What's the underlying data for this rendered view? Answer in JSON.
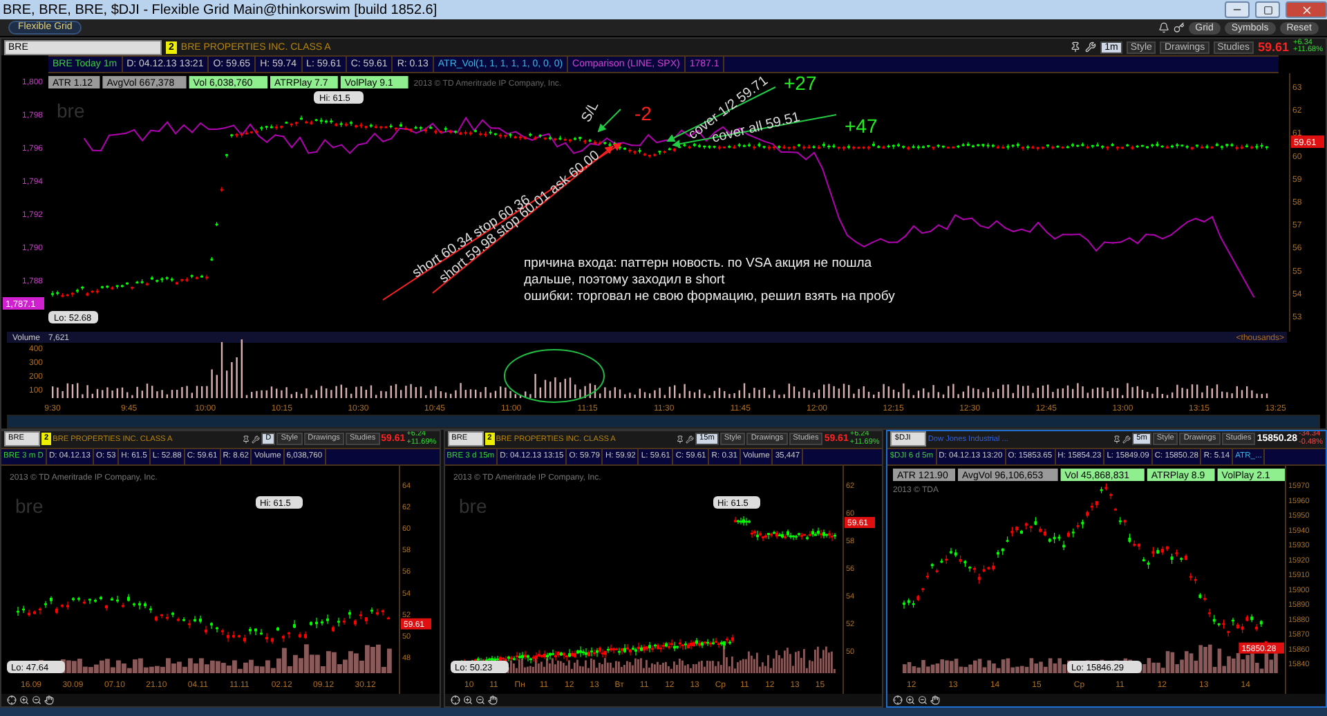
{
  "window": {
    "title": "BRE, BRE, BRE, $DJI - Flexible Grid Main@thinkorswim [build 1852.6]"
  },
  "toolbar": {
    "tab": "Flexible Grid",
    "buttons": [
      "Grid",
      "Symbols",
      "Reset"
    ]
  },
  "main_panel": {
    "symbol": "BRE",
    "badge": "2",
    "company": "BRE PROPERTIES INC. CLASS A",
    "timeframe": "1m",
    "tools": [
      "Style",
      "Drawings",
      "Studies"
    ],
    "last": "59.61",
    "change": "+6.34",
    "change_pct": "+11.68%",
    "info": [
      {
        "kind": "label",
        "text": "BRE Today 1m"
      },
      {
        "kind": "field",
        "text": "D: 04.12.13 13:21"
      },
      {
        "kind": "field",
        "text": "O: 59.65"
      },
      {
        "kind": "field",
        "text": "H: 59.74"
      },
      {
        "kind": "field",
        "text": "L: 59.61"
      },
      {
        "kind": "field",
        "text": "C: 59.61"
      },
      {
        "kind": "field",
        "text": "R: 0.13"
      },
      {
        "kind": "study",
        "text": "ATR_Vol(1, 1, 1, 1, 1, 0, 0, 0)"
      },
      {
        "kind": "compare",
        "text": "Comparison (LINE, SPX)"
      },
      {
        "kind": "compare",
        "text": "1787.1"
      }
    ],
    "studies": [
      {
        "kind": "plain",
        "text": "ATR 1.12"
      },
      {
        "kind": "plain",
        "text": "AvgVol 667,378"
      },
      {
        "kind": "hot",
        "text": "Vol 6,038,760"
      },
      {
        "kind": "hot",
        "text": "ATRPlay 7.7"
      },
      {
        "kind": "hot",
        "text": "VolPlay 9.1"
      }
    ],
    "copyright": "2013 © TD Ameritrade IP Company, Inc.",
    "logo": "bre",
    "left_ticks": [
      "1,800",
      "1,798",
      "1,796",
      "1,794",
      "1,792",
      "1,790",
      "1,788"
    ],
    "right_ticks": [
      "63",
      "62",
      "61",
      "60",
      "59",
      "58",
      "57",
      "56",
      "55",
      "54",
      "53"
    ],
    "hi": "Hi: 61.5",
    "lo": "Lo: 52.68",
    "left_tag": "1,787.1",
    "right_tag": "59.61",
    "annotations": [
      {
        "kind": "entry",
        "text": "short 60.34 stop 60.36"
      },
      {
        "kind": "entry",
        "text": "short 59.98 stop 60.01 ask 60.00"
      },
      {
        "kind": "stop",
        "text": "S/L"
      },
      {
        "kind": "exit",
        "text": "cover 1/2 59.71"
      },
      {
        "kind": "exit",
        "text": "cover all 59.51"
      }
    ],
    "results": [
      {
        "kind": "loss",
        "text": "-2"
      },
      {
        "kind": "gain",
        "text": "+27"
      },
      {
        "kind": "gain",
        "text": "+47"
      }
    ],
    "note": [
      "причина входа: паттерн новость. по VSA акция не пошла",
      "дальше, поэтому заходил в short",
      "ошибки: торговал не свою формацию, решил взять на пробу"
    ],
    "volume": {
      "label": "Volume",
      "value": "7,621",
      "unit": "<thousands>",
      "ticks": [
        "400",
        "300",
        "200",
        "100"
      ]
    },
    "time_ticks": [
      "9:30",
      "9:45",
      "10:00",
      "10:15",
      "10:30",
      "10:45",
      "11:00",
      "11:15",
      "11:30",
      "11:45",
      "12:00",
      "12:15",
      "12:30",
      "12:45",
      "13:00",
      "13:15",
      "13:25"
    ]
  },
  "bottom_panels": [
    {
      "kind": "daily",
      "selected": false,
      "symbol": "BRE",
      "badge": "2",
      "company": "BRE PROPERTIES INC. CLASS A",
      "timeframe": "D",
      "tools": [
        "Style",
        "Drawings",
        "Studies"
      ],
      "last": "59.61",
      "change": "+6.24",
      "change_pct": "+11.69%",
      "info": [
        {
          "kind": "label",
          "text": "BRE 3 m D"
        },
        {
          "kind": "field",
          "text": "D: 04.12.13"
        },
        {
          "kind": "field",
          "text": "O: 53"
        },
        {
          "kind": "field",
          "text": "H: 61.5"
        },
        {
          "kind": "field",
          "text": "L: 52.88"
        },
        {
          "kind": "field",
          "text": "C: 59.61"
        },
        {
          "kind": "field",
          "text": "R: 8.62"
        },
        {
          "kind": "field",
          "text": "Volume"
        },
        {
          "kind": "field",
          "text": "6,038,760"
        }
      ],
      "copyright": "2013 © TD Ameritrade IP Company, Inc.",
      "logo": "bre",
      "hi": "Hi: 61.5",
      "lo": "Lo: 47.64",
      "tag": "59.61",
      "y_ticks": [
        "64",
        "62",
        "60",
        "58",
        "56",
        "54",
        "52",
        "50",
        "48"
      ],
      "x_ticks": [
        "16.09",
        "30.09",
        "07.10",
        "21.10",
        "04.11",
        "11.11",
        "02.12",
        "09.12",
        "30.12"
      ]
    },
    {
      "kind": "intraday",
      "selected": false,
      "symbol": "BRE",
      "badge": "2",
      "company": "BRE PROPERTIES INC. CLASS A",
      "timeframe": "15m",
      "tools": [
        "Style",
        "Drawings",
        "Studies"
      ],
      "last": "59.61",
      "change": "+6.24",
      "change_pct": "+11.69%",
      "info": [
        {
          "kind": "label",
          "text": "BRE 3 d 15m"
        },
        {
          "kind": "field",
          "text": "D: 04.12.13 13:15"
        },
        {
          "kind": "field",
          "text": "O: 59.79"
        },
        {
          "kind": "field",
          "text": "H: 59.92"
        },
        {
          "kind": "field",
          "text": "L: 59.61"
        },
        {
          "kind": "field",
          "text": "C: 59.61"
        },
        {
          "kind": "field",
          "text": "R: 0.31"
        },
        {
          "kind": "field",
          "text": "Volume"
        },
        {
          "kind": "field",
          "text": "35,447"
        }
      ],
      "copyright": "2013 © TD Ameritrade IP Company, Inc.",
      "logo": "bre",
      "hi": "Hi: 61.5",
      "lo": "Lo: 50.23",
      "tag": "59.61",
      "y_ticks": [
        "62",
        "60",
        "58",
        "56",
        "54",
        "52",
        "50"
      ],
      "x_ticks": [
        "10",
        "11",
        "Пн",
        "11",
        "12",
        "13",
        "Вт",
        "11",
        "12",
        "13",
        "Ср",
        "11",
        "12",
        "13",
        "15"
      ]
    },
    {
      "kind": "index",
      "selected": true,
      "symbol": "$DJI",
      "company": "Dow Jones Industrial ...",
      "timeframe": "5m",
      "tools": [
        "Style",
        "Drawings",
        "Studies"
      ],
      "last": "15850.28",
      "change": "-34.34",
      "change_pct": "-0.48%",
      "info": [
        {
          "kind": "label",
          "text": "$DJI 6 d 5m"
        },
        {
          "kind": "field",
          "text": "D: 04.12.13 13:20"
        },
        {
          "kind": "field",
          "text": "O: 15853.65"
        },
        {
          "kind": "field",
          "text": "H: 15854.23"
        },
        {
          "kind": "field",
          "text": "L: 15849.09"
        },
        {
          "kind": "field",
          "text": "C: 15850.28"
        },
        {
          "kind": "field",
          "text": "R: 5.14"
        },
        {
          "kind": "study",
          "text": "ATR_..."
        }
      ],
      "studies": [
        {
          "kind": "plain",
          "text": "ATR 121.90"
        },
        {
          "kind": "plain",
          "text": "AvgVol 96,106,653"
        },
        {
          "kind": "hot",
          "text": "Vol 45,868,831"
        },
        {
          "kind": "hot",
          "text": "ATRPlay 8.9"
        },
        {
          "kind": "hot",
          "text": "VolPlay 2.1"
        }
      ],
      "copyright": "2013 © TDA",
      "lo": "Lo: 15846.29",
      "tag": "15850.28",
      "y_ticks": [
        "15970",
        "15960",
        "15950",
        "15940",
        "15930",
        "15920",
        "15910",
        "15900",
        "15890",
        "15880",
        "15870",
        "15860",
        "15840"
      ],
      "x_ticks": [
        "12",
        "13",
        "14",
        "15",
        "Ср",
        "11",
        "12",
        "13",
        "14"
      ]
    }
  ]
}
